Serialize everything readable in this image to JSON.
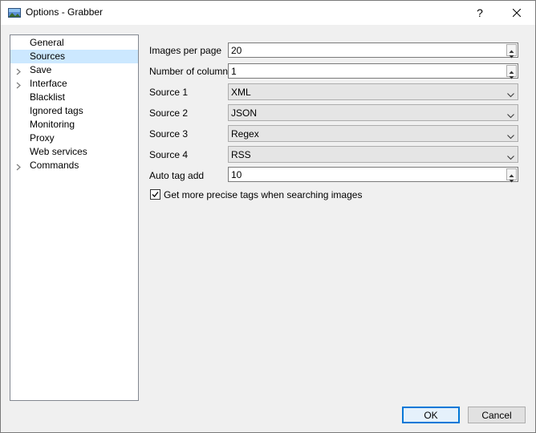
{
  "window": {
    "title": "Options - Grabber",
    "help_label": "?",
    "close_label": "✕"
  },
  "sidebar": {
    "items": [
      {
        "label": "General",
        "expandable": false,
        "selected": false
      },
      {
        "label": "Sources",
        "expandable": false,
        "selected": true
      },
      {
        "label": "Save",
        "expandable": true,
        "selected": false
      },
      {
        "label": "Interface",
        "expandable": true,
        "selected": false
      },
      {
        "label": "Blacklist",
        "expandable": false,
        "selected": false
      },
      {
        "label": "Ignored tags",
        "expandable": false,
        "selected": false
      },
      {
        "label": "Monitoring",
        "expandable": false,
        "selected": false
      },
      {
        "label": "Proxy",
        "expandable": false,
        "selected": false
      },
      {
        "label": "Web services",
        "expandable": false,
        "selected": false
      },
      {
        "label": "Commands",
        "expandable": true,
        "selected": false
      }
    ]
  },
  "form": {
    "images_per_page": {
      "label": "Images per page",
      "value": "20"
    },
    "number_of_columns": {
      "label": "Number of columns",
      "value": "1"
    },
    "source_1": {
      "label": "Source 1",
      "value": "XML"
    },
    "source_2": {
      "label": "Source 2",
      "value": "JSON"
    },
    "source_3": {
      "label": "Source 3",
      "value": "Regex"
    },
    "source_4": {
      "label": "Source 4",
      "value": "RSS"
    },
    "auto_tag_add": {
      "label": "Auto tag add",
      "value": "10"
    },
    "precise_tags": {
      "label": "Get more precise tags when searching images",
      "checked": true
    }
  },
  "buttons": {
    "ok_label": "OK",
    "cancel_label": "Cancel"
  },
  "colors": {
    "selection": "#cce8ff",
    "accent": "#0078d7"
  }
}
